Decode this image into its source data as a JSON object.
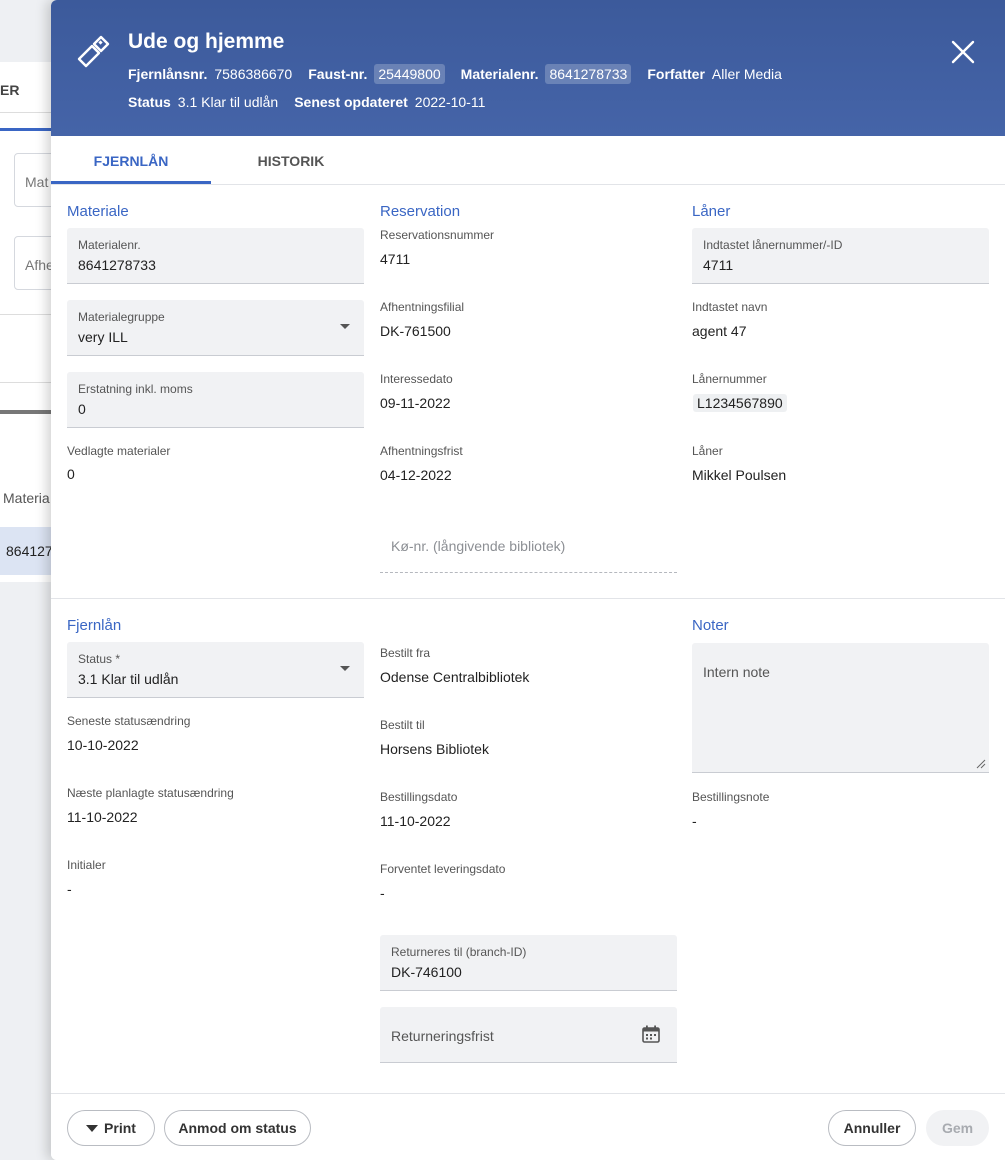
{
  "background": {
    "tab_fragment": "ER",
    "field1_fragment": "Mat",
    "field2_fragment": "Afhe",
    "column_fragment": "Materia",
    "row_fragment": "864127"
  },
  "header": {
    "title": "Ude og hjemme",
    "fjernlan_label": "Fjernlånsnr.",
    "fjernlan_value": "7586386670",
    "faust_label": "Faust-nr.",
    "faust_value": "25449800",
    "materialenr_label": "Materialenr.",
    "materialenr_value": "8641278733",
    "forfatter_label": "Forfatter",
    "forfatter_value": "Aller Media",
    "status_label": "Status",
    "status_value": "3.1 Klar til udlån",
    "opdateret_label": "Senest opdateret",
    "opdateret_value": "2022-10-11",
    "icon": "usb-stick-icon",
    "close_icon": "close-icon"
  },
  "tabs": [
    {
      "label": "FJERNLÅN",
      "active": true
    },
    {
      "label": "HISTORIK",
      "active": false
    }
  ],
  "materiale": {
    "heading": "Materiale",
    "materialenr_label": "Materialenr.",
    "materialenr_value": "8641278733",
    "materialegruppe_label": "Materialegruppe",
    "materialegruppe_value": "very ILL",
    "erstatning_label": "Erstatning inkl. moms",
    "erstatning_value": "0",
    "vedlagte_label": "Vedlagte materialer",
    "vedlagte_value": "0"
  },
  "reservation": {
    "heading": "Reservation",
    "nummer_label": "Reservationsnummer",
    "nummer_value": "4711",
    "filial_label": "Afhentningsfilial",
    "filial_value": "DK-761500",
    "interessedato_label": "Interessedato",
    "interessedato_value": "09-11-2022",
    "frist_label": "Afhentningsfrist",
    "frist_value": "04-12-2022",
    "ko_placeholder": "Kø-nr. (långivende bibliotek)"
  },
  "laner": {
    "heading": "Låner",
    "indtastet_label": "Indtastet lånernummer/-ID",
    "indtastet_value": "4711",
    "navn_label": "Indtastet navn",
    "navn_value": "agent 47",
    "lanernummer_label": "Lånernummer",
    "lanernummer_value": "L1234567890",
    "laner_label": "Låner",
    "laner_value": "Mikkel Poulsen"
  },
  "fjernlan": {
    "heading": "Fjernlån",
    "status_label": "Status *",
    "status_value": "3.1 Klar til udlån",
    "seneste_label": "Seneste statusændring",
    "seneste_value": "10-10-2022",
    "naeste_label": "Næste planlagte statusændring",
    "naeste_value": "11-10-2022",
    "initialer_label": "Initialer",
    "initialer_value": "-"
  },
  "bestilling": {
    "fra_label": "Bestilt fra",
    "fra_value": "Odense Centralbibliotek",
    "til_label": "Bestilt til",
    "til_value": "Horsens Bibliotek",
    "dato_label": "Bestillingsdato",
    "dato_value": "11-10-2022",
    "forventet_label": "Forventet leveringsdato",
    "forventet_value": "-",
    "returneres_label": "Returneres til (branch-ID)",
    "returneres_value": "DK-746100",
    "returneringsfrist_placeholder": "Returneringsfrist"
  },
  "noter": {
    "heading": "Noter",
    "intern_placeholder": "Intern note",
    "bestillingsnote_label": "Bestillingsnote",
    "bestillingsnote_value": "-"
  },
  "footer": {
    "print_label": "Print",
    "anmod_label": "Anmod om status",
    "annuller_label": "Annuller",
    "gem_label": "Gem"
  },
  "colors": {
    "header_bg": "#3d5fa3",
    "accent": "#3a66c4"
  }
}
